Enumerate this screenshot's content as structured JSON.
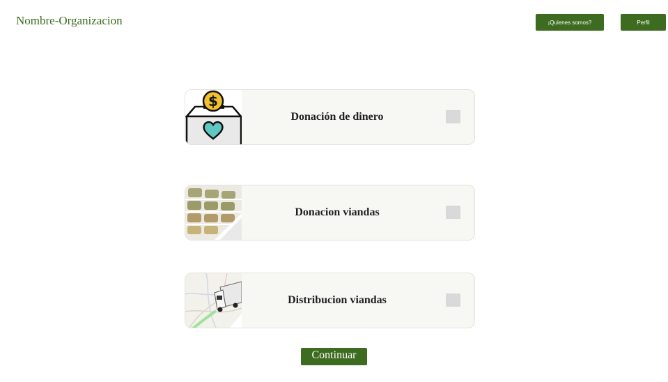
{
  "header": {
    "org_name": "Nombre-Organizacion",
    "about_label": "¡Quienes somos?",
    "profile_label": "Perfil"
  },
  "options": [
    {
      "label": "Donación de dinero",
      "icon": "donation-box-icon"
    },
    {
      "label": "Donacion viandas",
      "icon": "food-containers-image"
    },
    {
      "label": "Distribucion viandas",
      "icon": "delivery-truck-map-image"
    }
  ],
  "continue_label": "Continuar",
  "colors": {
    "accent": "#3d6b1f",
    "card_bg": "#f7f7f4",
    "checkbox": "#d9d9d9"
  }
}
